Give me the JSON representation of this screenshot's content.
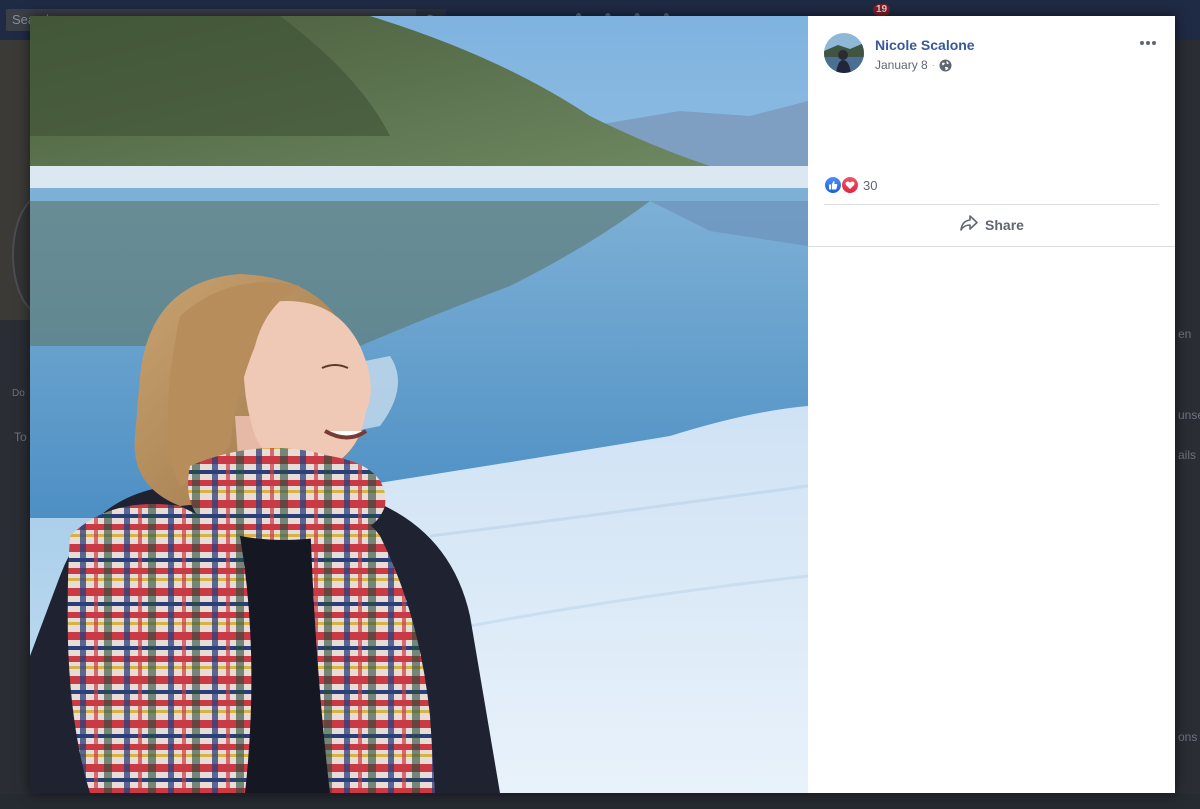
{
  "background": {
    "search_placeholder": "Search",
    "notification_count": "19",
    "fragments": [
      "Do",
      "To",
      "en",
      "unsel",
      "ails",
      "ons"
    ]
  },
  "post": {
    "author_name": "Nicole Scalone",
    "date": "January 8",
    "meta_separator": "·",
    "privacy_icon": "globe-icon",
    "options_icon": "more-options-icon",
    "reaction_icons": [
      "like-reaction-icon",
      "love-reaction-icon"
    ],
    "reaction_count": "30",
    "share_label": "Share",
    "share_icon": "share-arrow-icon"
  },
  "colors": {
    "author_link": "#385898",
    "like_blue": "#1877f2",
    "love_red": "#f33e58",
    "muted_text": "#606770"
  }
}
